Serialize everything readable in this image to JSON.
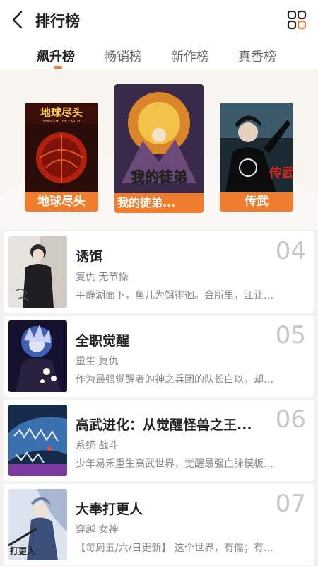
{
  "header": {
    "title": "排行榜",
    "back_icon": "chevron-left-icon",
    "menu_icon": "grid-icon"
  },
  "tabs": [
    {
      "label": "飙升榜",
      "active": true
    },
    {
      "label": "畅销榜",
      "active": false
    },
    {
      "label": "新作榜",
      "active": false
    },
    {
      "label": "真香榜",
      "active": false
    }
  ],
  "top3": [
    {
      "label": "地球尽头",
      "cover_text": "地球尽头",
      "cover_sub": "ENDS OF THE EARTH"
    },
    {
      "label": "我的徒弟...",
      "cover_text": "我的徒弟"
    },
    {
      "label": "传武",
      "cover_text": "传武"
    }
  ],
  "items": [
    {
      "rank": "04",
      "name": "诱饵",
      "tags": "复仇 无节操",
      "desc": "平静湖面下，鱼儿为饵徘徊。会所里，江让…"
    },
    {
      "rank": "05",
      "name": "全职觉醒",
      "tags": "重生 复仇",
      "desc": "作为最强觉醒者的神之兵团的队长白以，却…"
    },
    {
      "rank": "06",
      "name": "高武进化：从觉醒怪兽之王...",
      "tags": "系统 战斗",
      "desc": "少年易禾重生高武世界，觉醒最强血脉模板…"
    },
    {
      "rank": "07",
      "name": "大奉打更人",
      "tags": "穿越 女神",
      "desc": "【每周五/六/日更新】 这个世界，有儒；有…"
    }
  ],
  "colors": {
    "accent": "#f07c2e",
    "rank": "#c8c8c8"
  }
}
